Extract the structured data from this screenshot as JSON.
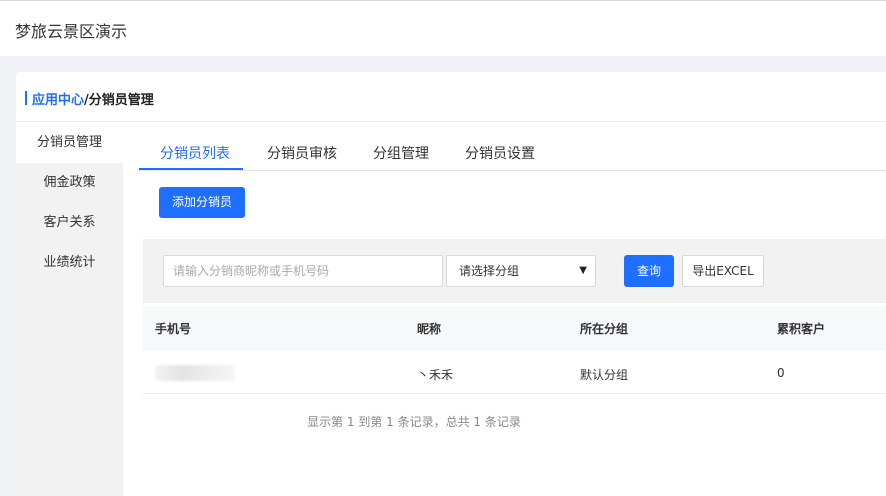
{
  "app_title": "梦旅云景区演示",
  "breadcrumb": {
    "link": "应用中心",
    "separator": "/",
    "current": "分销员管理"
  },
  "sidebar": {
    "items": [
      {
        "label": "分销员管理"
      },
      {
        "label": "佣金政策"
      },
      {
        "label": "客户关系"
      },
      {
        "label": "业绩统计"
      }
    ]
  },
  "tabs": [
    {
      "label": "分销员列表"
    },
    {
      "label": "分销员审核"
    },
    {
      "label": "分组管理"
    },
    {
      "label": "分销员设置"
    }
  ],
  "add_button": "添加分销员",
  "filter": {
    "search_placeholder": "请输入分销商昵称或手机号码",
    "group_select": "请选择分组",
    "query_button": "查询",
    "export_button": "导出EXCEL"
  },
  "table": {
    "headers": [
      "手机号",
      "昵称",
      "所在分组",
      "累积客户"
    ],
    "rows": [
      {
        "phone": "",
        "nickname": "丶禾禾",
        "group": "默认分组",
        "customers": "0"
      }
    ]
  },
  "pagination": "显示第 1 到第 1 条记录，总共 1 条记录",
  "colors": {
    "accent": "#1e6fff"
  }
}
